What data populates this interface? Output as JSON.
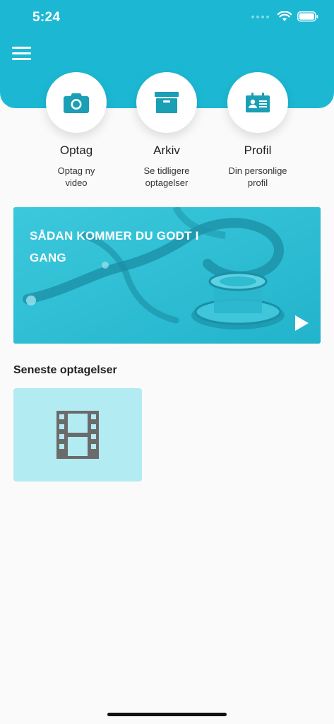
{
  "status_bar": {
    "time": "5:24"
  },
  "actions": [
    {
      "title": "Optag",
      "subtitle": "Optag ny\nvideo",
      "icon": "camera-icon"
    },
    {
      "title": "Arkiv",
      "subtitle": "Se tidligere\noptagelser",
      "icon": "archive-box-icon"
    },
    {
      "title": "Profil",
      "subtitle": "Din personlige\nprofil",
      "icon": "id-card-icon"
    }
  ],
  "banner": {
    "title": "SÅDAN KOMMER DU GODT I GANG"
  },
  "recent": {
    "title": "Seneste optagelser"
  },
  "colors": {
    "brand": "#1cb8d3",
    "icon": "#1a9fb5",
    "tile": "#b3ebf2",
    "film_icon": "#6b6b6b"
  }
}
